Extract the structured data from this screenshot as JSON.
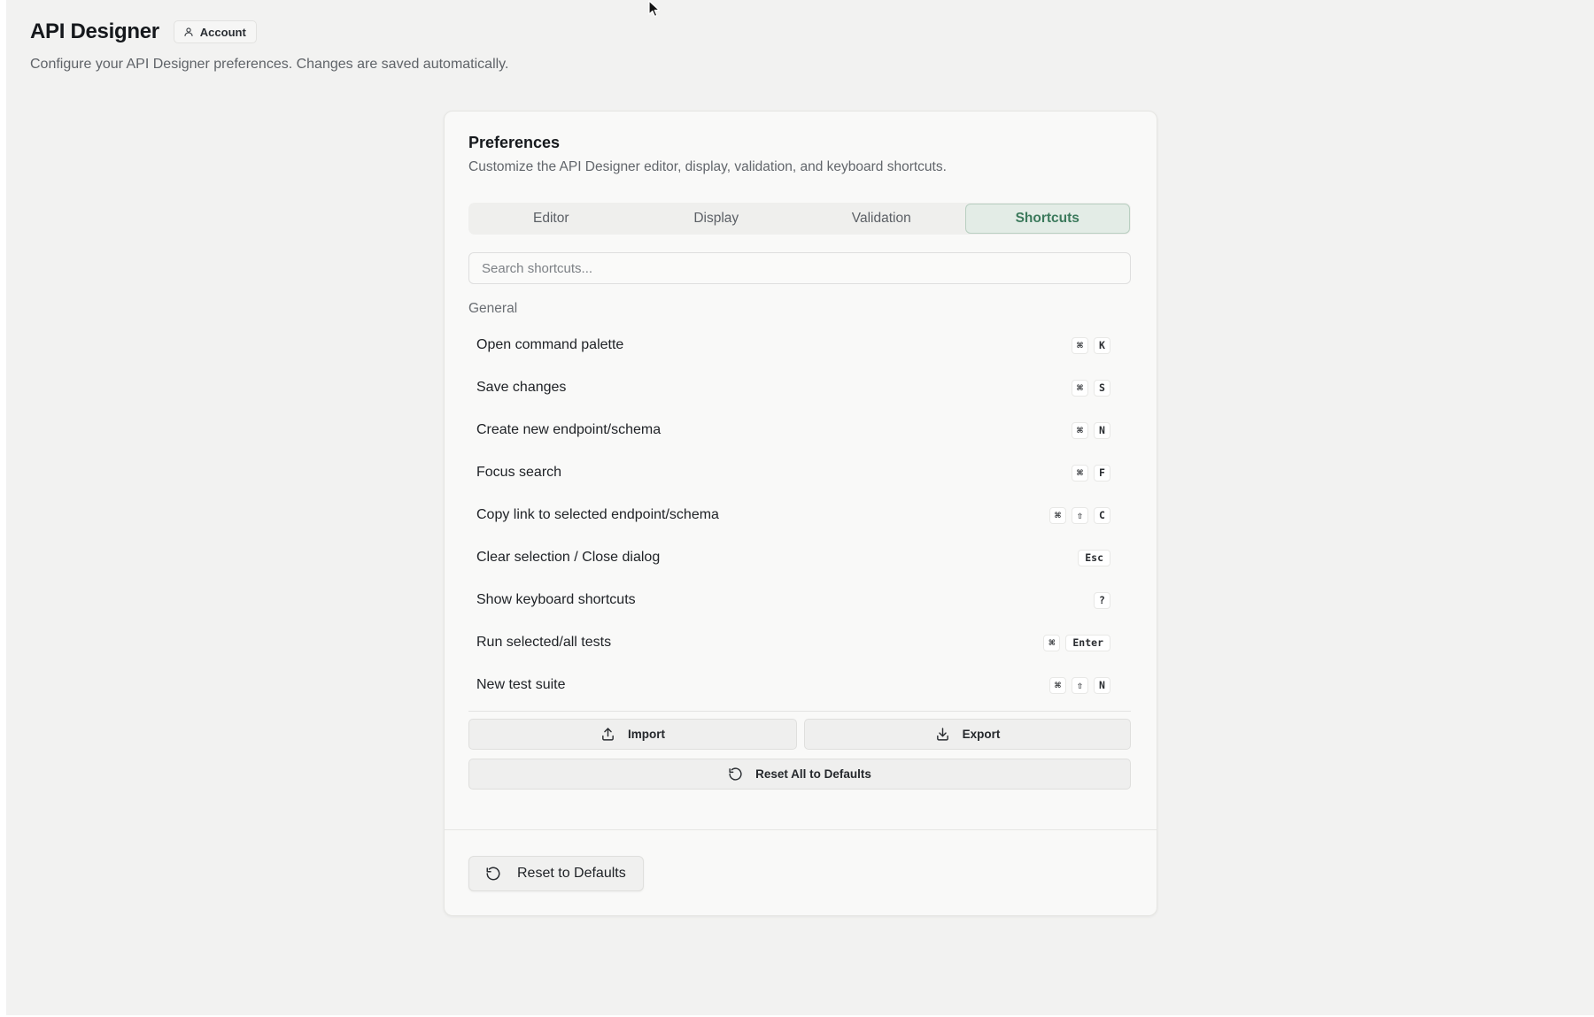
{
  "header": {
    "title": "API Designer",
    "account_label": "Account",
    "subtitle": "Configure your API Designer preferences. Changes are saved automatically."
  },
  "preferences": {
    "title": "Preferences",
    "description": "Customize the API Designer editor, display, validation, and keyboard shortcuts.",
    "tabs": [
      {
        "label": "Editor",
        "active": false
      },
      {
        "label": "Display",
        "active": false
      },
      {
        "label": "Validation",
        "active": false
      },
      {
        "label": "Shortcuts",
        "active": true
      }
    ],
    "search": {
      "placeholder": "Search shortcuts...",
      "value": ""
    },
    "section_label": "General",
    "shortcuts": [
      {
        "label": "Open command palette",
        "keys": [
          "⌘",
          "K"
        ]
      },
      {
        "label": "Save changes",
        "keys": [
          "⌘",
          "S"
        ]
      },
      {
        "label": "Create new endpoint/schema",
        "keys": [
          "⌘",
          "N"
        ]
      },
      {
        "label": "Focus search",
        "keys": [
          "⌘",
          "F"
        ]
      },
      {
        "label": "Copy link to selected endpoint/schema",
        "keys": [
          "⌘",
          "⇧",
          "C"
        ]
      },
      {
        "label": "Clear selection / Close dialog",
        "keys": [
          "Esc"
        ]
      },
      {
        "label": "Show keyboard shortcuts",
        "keys": [
          "?"
        ]
      },
      {
        "label": "Run selected/all tests",
        "keys": [
          "⌘",
          "Enter"
        ]
      },
      {
        "label": "New test suite",
        "keys": [
          "⌘",
          "⇧",
          "N"
        ]
      }
    ],
    "import_label": "Import",
    "export_label": "Export",
    "reset_all_label": "Reset All to Defaults"
  },
  "footer": {
    "reset_label": "Reset to Defaults"
  },
  "icons": {
    "account": "user-icon",
    "import": "upload-icon",
    "export": "download-icon",
    "reset": "rotate-ccw-icon"
  },
  "colors": {
    "active_tab_text": "#3c7a5c",
    "active_tab_bg": "#e3ece6",
    "background": "#f2f2f1",
    "card": "#f9f9f8"
  }
}
